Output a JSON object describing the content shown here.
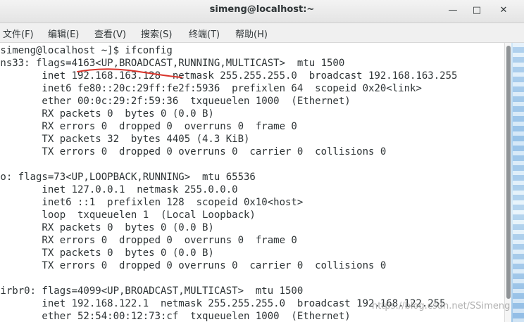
{
  "window": {
    "title": "simeng@localhost:~",
    "minimize_glyph": "—",
    "maximize_glyph": "□",
    "close_glyph": "✕"
  },
  "menu": {
    "items": [
      "文件(F)",
      "编辑(E)",
      "查看(V)",
      "搜索(S)",
      "终端(T)",
      "帮助(H)"
    ]
  },
  "terminal": {
    "lines": [
      "[simeng@localhost ~]$ ifconfig",
      "ens33: flags=4163<UP,BROADCAST,RUNNING,MULTICAST>  mtu 1500",
      "        inet 192.168.163.128  netmask 255.255.255.0  broadcast 192.168.163.255",
      "        inet6 fe80::20c:29ff:fe2f:5936  prefixlen 64  scopeid 0x20<link>",
      "        ether 00:0c:29:2f:59:36  txqueuelen 1000  (Ethernet)",
      "        RX packets 0  bytes 0 (0.0 B)",
      "        RX errors 0  dropped 0  overruns 0  frame 0",
      "        TX packets 32  bytes 4405 (4.3 KiB)",
      "        TX errors 0  dropped 0 overruns 0  carrier 0  collisions 0",
      "",
      "lo: flags=73<UP,LOOPBACK,RUNNING>  mtu 65536",
      "        inet 127.0.0.1  netmask 255.0.0.0",
      "        inet6 ::1  prefixlen 128  scopeid 0x10<host>",
      "        loop  txqueuelen 1  (Local Loopback)",
      "        RX packets 0  bytes 0 (0.0 B)",
      "        RX errors 0  dropped 0  overruns 0  frame 0",
      "        TX packets 0  bytes 0 (0.0 B)",
      "        TX errors 0  dropped 0 overruns 0  carrier 0  collisions 0",
      "",
      "virbr0: flags=4099<UP,BROADCAST,MULTICAST>  mtu 1500",
      "        inet 192.168.122.1  netmask 255.255.255.0  broadcast 192.168.122.255",
      "        ether 52:54:00:12:73:cf  txqueuelen 1000  (Ethernet)"
    ]
  },
  "overlay": {
    "watermark": "https://blog.csdn.net/SSimeng",
    "annotation_color": "#d9342b"
  }
}
